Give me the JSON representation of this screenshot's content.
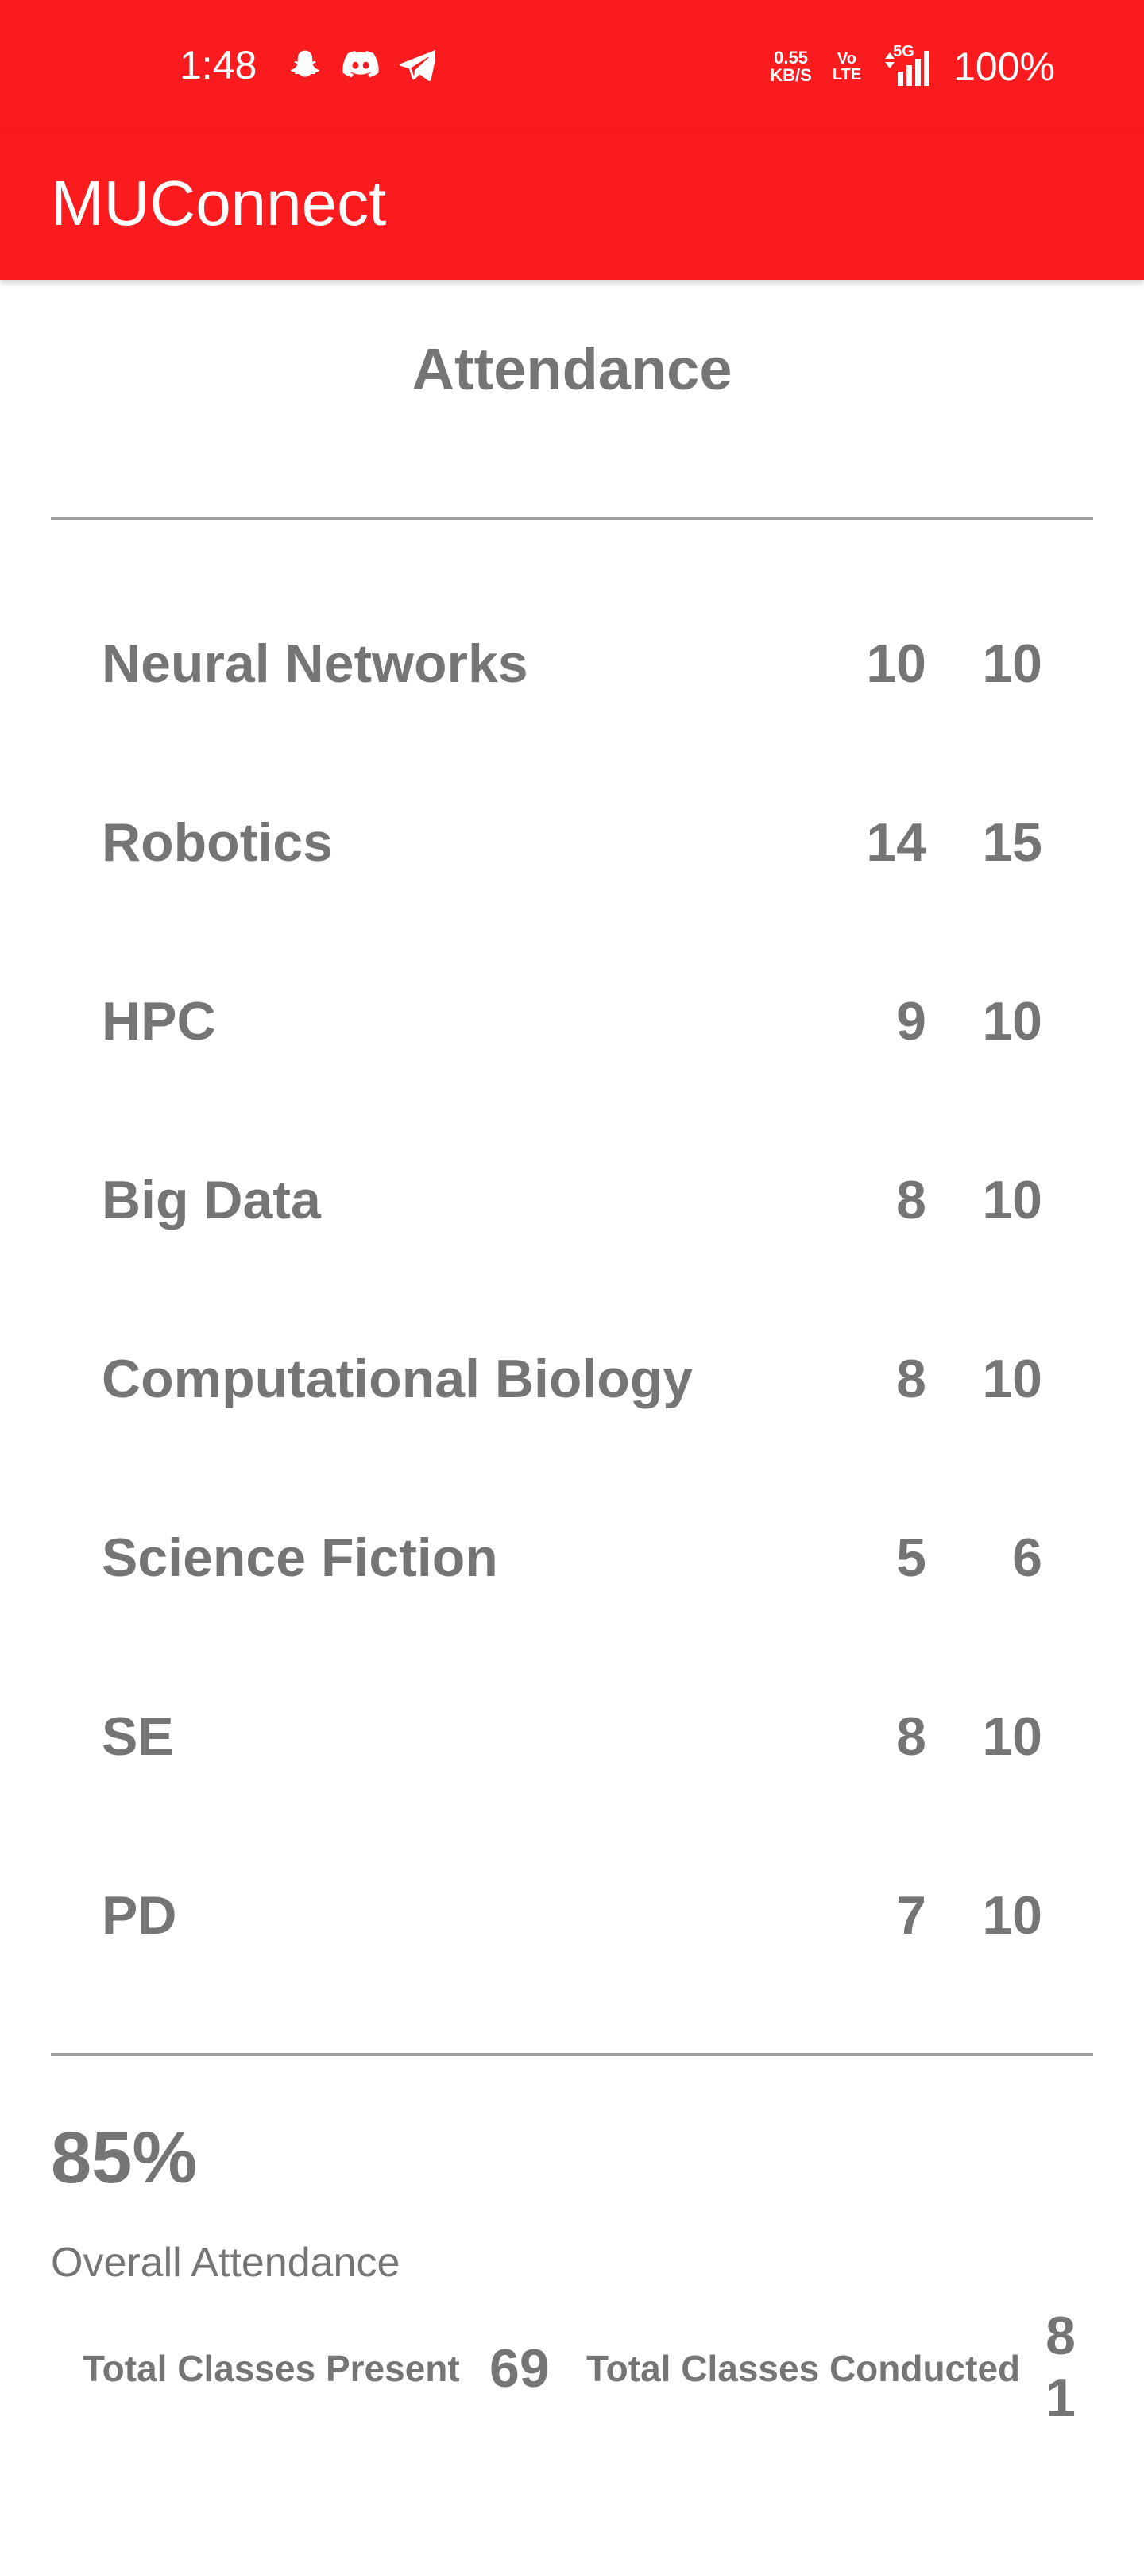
{
  "status_bar": {
    "time": "1:48",
    "icons_left": [
      "snapchat-icon",
      "discord-icon",
      "telegram-icon"
    ],
    "net_speed_value": "0.55",
    "net_speed_unit": "KB/S",
    "volte_top": "Vo",
    "volte_bottom": "LTE",
    "network": "5G",
    "battery": "100%"
  },
  "app_bar": {
    "title": "MUConnect",
    "background": "#fa1b1e"
  },
  "page": {
    "title": "Attendance"
  },
  "courses": [
    {
      "name": "Neural Networks",
      "present": "10",
      "total": "10"
    },
    {
      "name": "Robotics",
      "present": "14",
      "total": "15"
    },
    {
      "name": "HPC",
      "present": "9",
      "total": "10"
    },
    {
      "name": "Big Data",
      "present": "8",
      "total": "10"
    },
    {
      "name": "Computational Biology",
      "present": "8",
      "total": "10"
    },
    {
      "name": "Science Fiction",
      "present": "5",
      "total": "6"
    },
    {
      "name": "SE",
      "present": "8",
      "total": "10"
    },
    {
      "name": "PD",
      "present": "7",
      "total": "10"
    }
  ],
  "summary": {
    "overall_percentage": "85%",
    "overall_label": "Overall Attendance",
    "present_label": "Total Classes Present",
    "present_value": "69",
    "conducted_label": "Total Classes Conducted",
    "conducted_value": "81"
  }
}
